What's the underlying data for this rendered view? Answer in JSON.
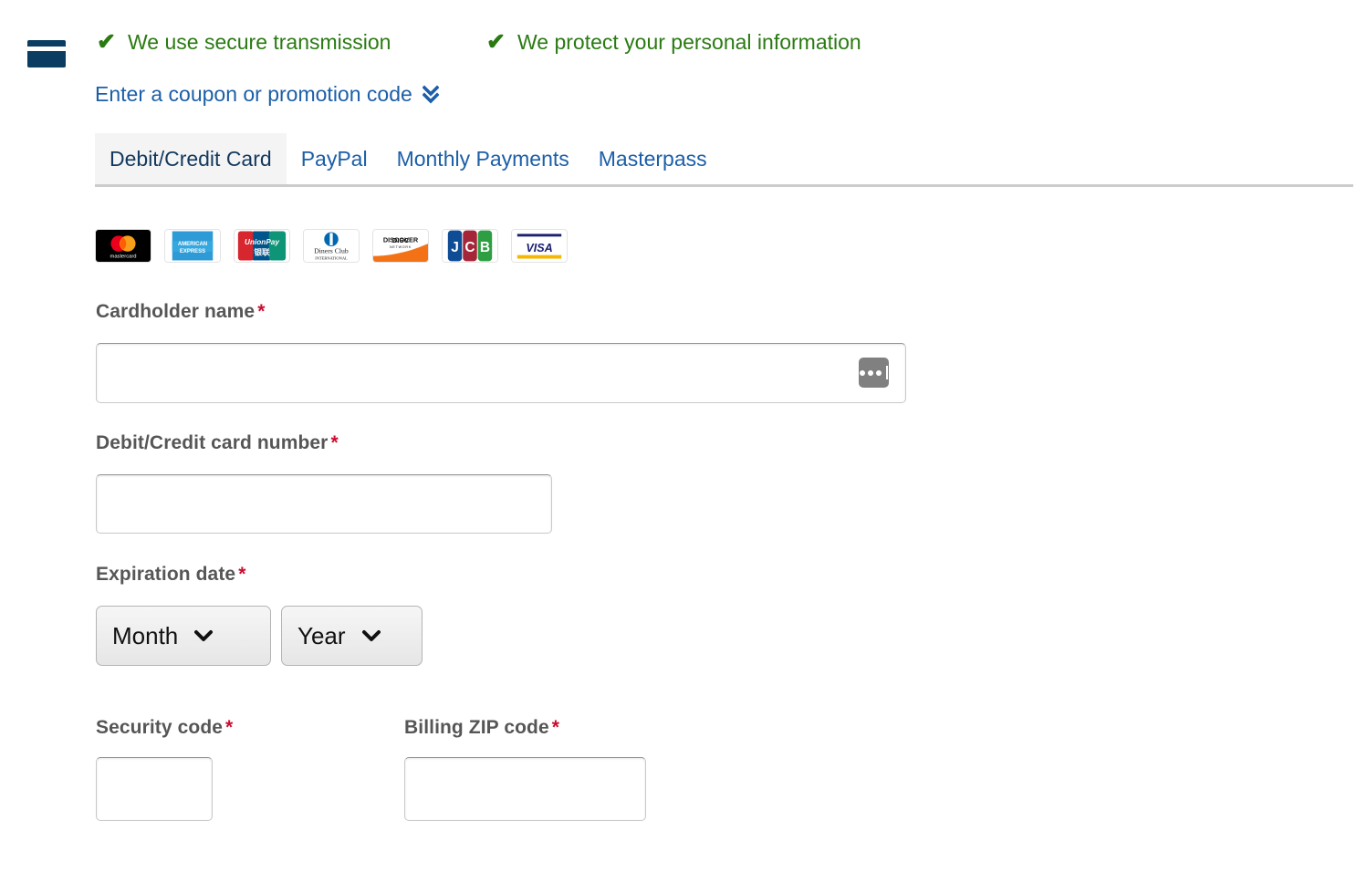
{
  "header": {
    "card_icon": "credit-card-icon",
    "assurances": [
      {
        "icon": "check-icon",
        "text": "We use secure transmission"
      },
      {
        "icon": "check-icon",
        "text": "We protect your personal information"
      }
    ],
    "coupon_link": {
      "text": "Enter a coupon or promotion code",
      "icon": "double-chevron-down-icon"
    }
  },
  "tabs": {
    "items": [
      {
        "label": "Debit/Credit Card",
        "active": true
      },
      {
        "label": "PayPal",
        "active": false
      },
      {
        "label": "Monthly Payments",
        "active": false
      },
      {
        "label": "Masterpass",
        "active": false
      }
    ]
  },
  "accepted_cards": [
    {
      "name": "mastercard",
      "label": "mastercard"
    },
    {
      "name": "american-express",
      "label": "AMERICAN EXPRESS"
    },
    {
      "name": "unionpay",
      "label": "UnionPay 银联"
    },
    {
      "name": "diners-club",
      "label": "Diners Club INTERNATIONAL"
    },
    {
      "name": "discover",
      "label": "DISCOVER NETWORK"
    },
    {
      "name": "jcb",
      "label": "JCB"
    },
    {
      "name": "visa",
      "label": "VISA"
    }
  ],
  "form": {
    "cardholder_name": {
      "label": "Cardholder name",
      "required_marker": "*",
      "value": "",
      "placeholder": "",
      "autofill_icon": "password-autofill-icon"
    },
    "card_number": {
      "label": "Debit/Credit card number",
      "required_marker": "*",
      "value": "",
      "placeholder": ""
    },
    "expiration": {
      "label": "Expiration date",
      "required_marker": "*",
      "month": {
        "selected": "Month",
        "caret_icon": "chevron-down-icon"
      },
      "year": {
        "selected": "Year",
        "caret_icon": "chevron-down-icon"
      }
    },
    "security_code": {
      "label": "Security code",
      "required_marker": "*",
      "value": "",
      "placeholder": ""
    },
    "billing_zip": {
      "label": "Billing ZIP code",
      "required_marker": "*",
      "value": "",
      "placeholder": ""
    }
  },
  "colors": {
    "link_blue": "#1c5fa8",
    "assurance_green": "#2a7a12",
    "required_red": "#cc0c2f",
    "active_tab_text": "#13395e",
    "card_icon_navy": "#0b3c61"
  }
}
